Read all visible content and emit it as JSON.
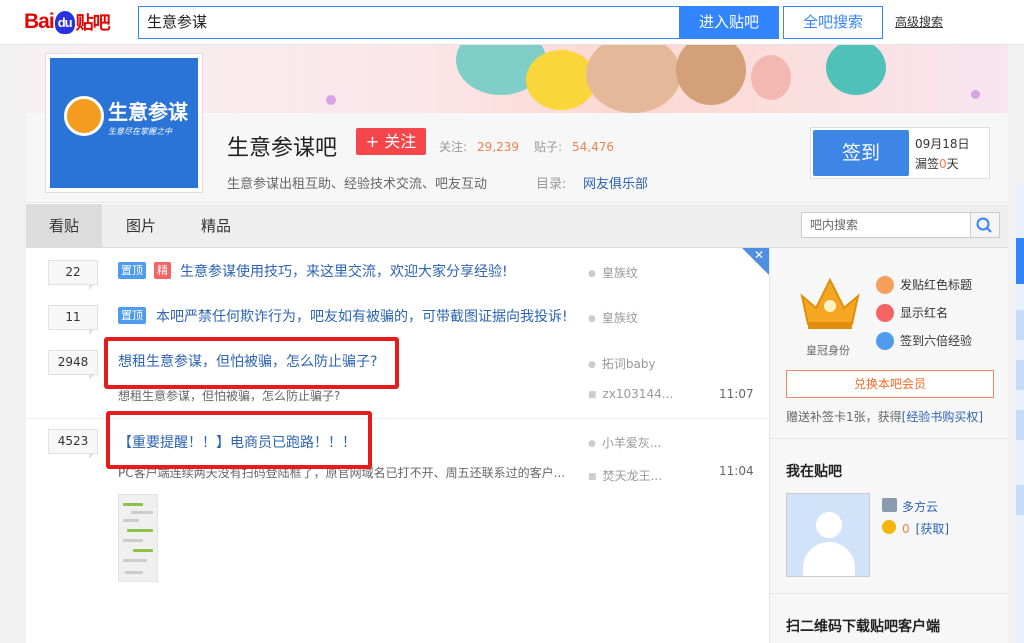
{
  "header": {
    "logo": {
      "bai": "Bai",
      "du": "du",
      "tieba": "贴吧"
    },
    "search_value": "生意参谋",
    "enter_button": "进入贴吧",
    "all_search_button": "全吧搜索",
    "advanced_search": "高级搜索"
  },
  "forum": {
    "avatar_title": "生意参谋",
    "avatar_sub": "生意尽在掌握之中",
    "name": "生意参谋吧",
    "follow_button": "+ 关注",
    "followers_label": "关注:",
    "followers": "29,239",
    "posts_label": "贴子:",
    "posts": "54,476",
    "description": "生意参谋出租互助、经验技术交流、吧友互动",
    "category_label": "目录:",
    "category": "网友俱乐部",
    "sign_button": "签到",
    "sign_date": "09月18日",
    "sign_miss_prefix": "漏签",
    "sign_miss_days": "0",
    "sign_miss_suffix": "天"
  },
  "tabs": [
    "看贴",
    "图片",
    "精品"
  ],
  "inner_search_placeholder": "吧内搜索",
  "threads": [
    {
      "replies": "22",
      "tags": [
        "置顶",
        "精"
      ],
      "title": "生意参谋使用技巧，来这里交流，欢迎大家分享经验!",
      "author": "皇族纹"
    },
    {
      "replies": "11",
      "tags": [
        "置顶"
      ],
      "title": "本吧严禁任何欺诈行为，吧友如有被骗的，可带截图证据向我投诉!",
      "author": "皇族纹"
    },
    {
      "replies": "2948",
      "title": "想租生意参谋，但怕被骗，怎么防止骗子?",
      "author": "拓词baby",
      "preview": "想租生意参谋，但怕被骗，怎么防止骗子?",
      "last_reply": "zx103144...",
      "time": "11:07"
    },
    {
      "replies": "4523",
      "title": "【重要提醒！！】电商员已跑路！！！",
      "author": "小羊爱灰...",
      "preview": "PC客户端连续两天没有扫码登陆框了，原官网域名已打不开、周五还联系过的客户...",
      "last_reply": "焚天龙王...",
      "time": "11:04"
    }
  ],
  "sidebar": {
    "crown_label": "皇冠身份",
    "perks": [
      "发贴红色标题",
      "显示红名",
      "签到六倍经验"
    ],
    "vip_button": "兑换本吧会员",
    "card_note_prefix": "赠送补签卡1张，获得",
    "card_note_link": "[经验书购买权]",
    "my_section_title": "我在贴吧",
    "user_name": "多方云",
    "coin_count": "0",
    "coin_link": "[获取]",
    "qr_title": "扫二维码下载贴吧客户端"
  },
  "colors": {
    "accent": "#3385ff",
    "follow": "#f5464b",
    "highlight_box": "#e81b1b",
    "link": "#2d64b3"
  }
}
